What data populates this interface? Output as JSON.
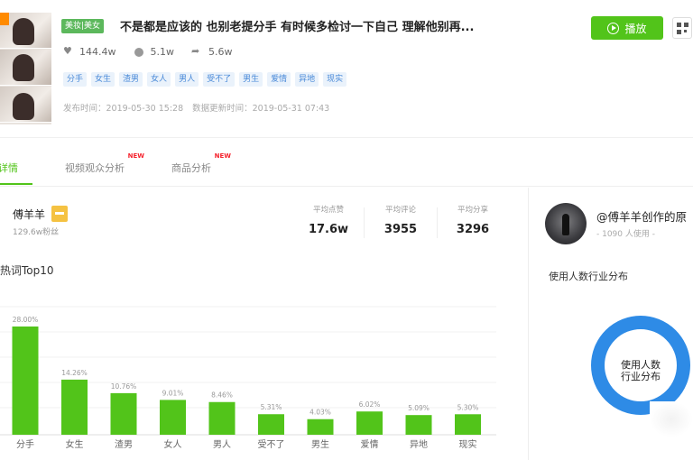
{
  "video": {
    "category_tag": "美妆|美女",
    "title": "不是都是应该的 也别老提分手 有时候多检讨一下自己 理解他别再...",
    "play_label": "播放",
    "stats": {
      "likes": "144.4w",
      "comments": "5.1w",
      "shares": "5.6w"
    },
    "tags": [
      "分手",
      "女生",
      "渣男",
      "女人",
      "男人",
      "受不了",
      "男生",
      "爱情",
      "异地",
      "现实"
    ],
    "published_label": "发布时间：2019-05-30 15:28",
    "updated_label": "数据更新时间：2019-05-31 07:43"
  },
  "tabs": [
    {
      "label": "详情",
      "new": "",
      "active": true
    },
    {
      "label": "视频观众分析",
      "new": "NEW",
      "active": false
    },
    {
      "label": "商品分析",
      "new": "NEW",
      "active": false
    }
  ],
  "author": {
    "name": "傅羊羊",
    "fans": "129.6w粉丝",
    "metrics": [
      {
        "label": "平均点赞",
        "value": "17.6w"
      },
      {
        "label": "平均评论",
        "value": "3955"
      },
      {
        "label": "平均分享",
        "value": "3296"
      }
    ]
  },
  "chart_title": "热词Top10",
  "chart_data": {
    "type": "bar",
    "categories": [
      "分手",
      "女生",
      "渣男",
      "女人",
      "男人",
      "受不了",
      "男生",
      "爱情",
      "异地",
      "现实"
    ],
    "values": [
      28.0,
      14.26,
      10.76,
      9.01,
      8.46,
      5.31,
      4.03,
      6.02,
      5.09,
      5.3
    ],
    "value_labels": [
      "28.00%",
      "14.26%",
      "10.76%",
      "9.01%",
      "8.46%",
      "5.31%",
      "4.03%",
      "6.02%",
      "5.09%",
      "5.30%"
    ],
    "bar_color": "#52c41a",
    "grid": true
  },
  "creator": {
    "name": "@傅羊羊创作的原",
    "usage_count": "- 1090 人使用 -",
    "distribution_title": "使用人数行业分布",
    "donut_label": [
      "使用人数",
      "行业分布"
    ],
    "donut_color": "#2e8be6"
  }
}
